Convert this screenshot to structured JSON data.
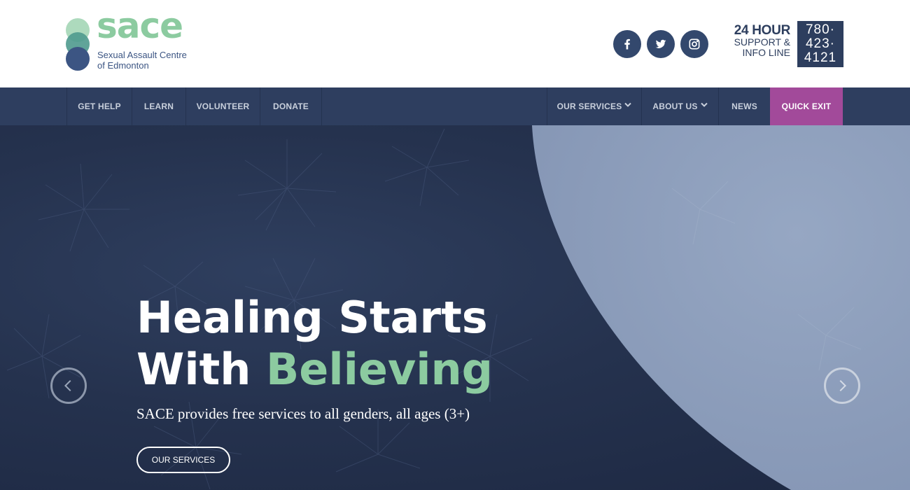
{
  "logo": {
    "word": "sace",
    "subtitle_line1": "Sexual Assault Centre",
    "subtitle_line2": "of Edmonton"
  },
  "social": [
    {
      "icon": "facebook-icon"
    },
    {
      "icon": "twitter-icon"
    },
    {
      "icon": "instagram-icon"
    }
  ],
  "hotline": {
    "title": "24 HOUR",
    "line2": "SUPPORT &",
    "line3": "INFO LINE",
    "number1": "780·",
    "number2": "423·",
    "number3": "4121"
  },
  "nav": {
    "left": [
      "GET HELP",
      "LEARN",
      "VOLUNTEER",
      "DONATE"
    ],
    "right": [
      "OUR SERVICES",
      "ABOUT US",
      "NEWS"
    ],
    "quick_exit": "QUICK EXIT"
  },
  "hero": {
    "heading_line1": "Healing Starts",
    "heading_line2_white": "With ",
    "heading_line2_green": "Believing",
    "subtext": "SACE provides free services to all genders, all ages (3+)",
    "button": "OUR SERVICES"
  },
  "colors": {
    "navy": "#2e3e5f",
    "green": "#8ccba0",
    "purple": "#a24a9a",
    "lavender": "#8d9fbd"
  }
}
